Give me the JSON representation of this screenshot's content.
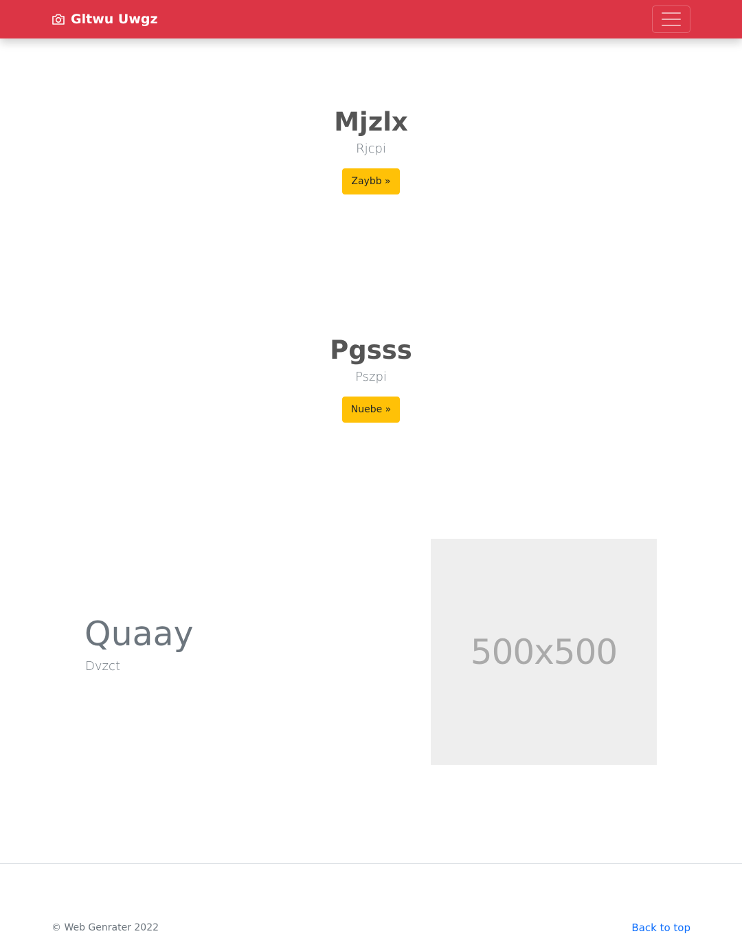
{
  "navbar": {
    "brand": "Gltwu Uwgz",
    "brand_icon": "camera-icon",
    "toggler_icon": "hamburger-menu-icon",
    "background": "#dc3545"
  },
  "hero1": {
    "title": "Mjzlx",
    "subtitle": "Rjcpi",
    "button_label": "Zaybb »"
  },
  "hero2": {
    "title": "Pgsss",
    "subtitle": "Pszpi",
    "button_label": "Nuebe »"
  },
  "feature": {
    "title": "Quaay",
    "subtitle": "Dvzct",
    "image_placeholder": "500x500"
  },
  "footer": {
    "copyright": "© Web Genrater 2022",
    "back_to_top": "Back to top"
  },
  "colors": {
    "button": "#ffc107",
    "link": "#0d6efd",
    "placeholder_bg": "#eeeeee"
  }
}
